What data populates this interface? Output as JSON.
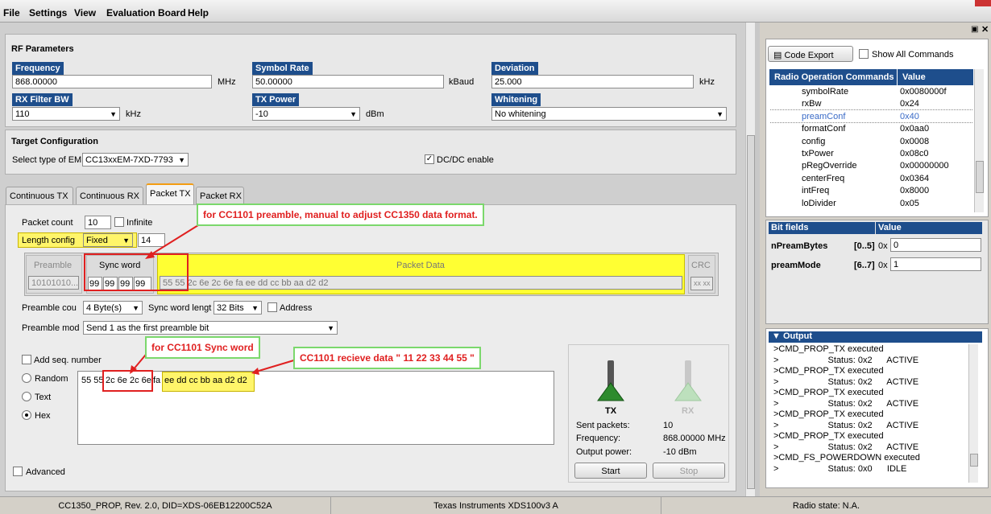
{
  "menu": [
    "File",
    "Settings",
    "View",
    "Evaluation Board",
    "Help"
  ],
  "rf": {
    "title": "RF Parameters",
    "frequency": {
      "label": "Frequency",
      "value": "868.00000",
      "unit": "MHz"
    },
    "symbol_rate": {
      "label": "Symbol Rate",
      "value": "50.00000",
      "unit": "kBaud"
    },
    "deviation": {
      "label": "Deviation",
      "value": "25.000",
      "unit": "kHz"
    },
    "rx_filter": {
      "label": "RX Filter BW",
      "value": "110",
      "unit": "kHz"
    },
    "tx_power": {
      "label": "TX Power",
      "value": "-10",
      "unit": "dBm"
    },
    "whitening": {
      "label": "Whitening",
      "value": "No whitening"
    }
  },
  "target": {
    "title": "Target Configuration",
    "em_label": "Select type of EM",
    "em_value": "CC13xxEM-7XD-7793",
    "dcdc_label": "DC/DC enable"
  },
  "tabs": [
    "Continuous TX",
    "Continuous RX",
    "Packet TX",
    "Packet RX"
  ],
  "packet": {
    "count_label": "Packet count",
    "count_value": "10",
    "infinite_label": "Infinite",
    "length_label": "Length config",
    "length_value": "Fixed",
    "length_num": "14",
    "preamble_head": "Preamble",
    "preamble_val": "10101010...",
    "sync_head": "Sync word",
    "sync_bytes": [
      "99",
      "99",
      "99",
      "99"
    ],
    "data_head": "Packet Data",
    "data_val": "55 55 2c 6e 2c 6e fa ee dd cc bb aa d2 d2",
    "crc_head": "CRC",
    "crc_val": "xx xx",
    "pre_count_label": "Preamble cou",
    "pre_count_val": "4 Byte(s)",
    "sync_len_label": "Sync word lengt",
    "sync_len_val": "32 Bits",
    "address_label": "Address",
    "pre_mode_label": "Preamble mod",
    "pre_mode_val": "Send 1 as the first preamble bit",
    "seq_label": "Add seq. number",
    "random_label": "Random",
    "text_label": "Text",
    "hex_label": "Hex",
    "payload_a": "55 55",
    "payload_b": "2c 6e 2c 6e",
    "payload_c": "fa",
    "payload_d": "ee dd cc bb aa d2 d2",
    "advanced_label": "Advanced"
  },
  "annotations": {
    "a1": "for CC1101 preamble, manual to adjust CC1350 data format.",
    "a2": "for CC1101 Sync word",
    "a3": "CC1101 recieve data \" 11 22 33 44 55 \""
  },
  "status": {
    "tx_label": "TX",
    "rx_label": "RX",
    "sent_label": "Sent packets:",
    "sent_val": "10",
    "freq_label": "Frequency:",
    "freq_val": "868.00000 MHz",
    "pow_label": "Output power:",
    "pow_val": "-10 dBm",
    "start": "Start",
    "stop": "Stop"
  },
  "right": {
    "code_export": "Code Export",
    "show_all": "Show All Commands",
    "col1": "Radio Operation Commands",
    "col2": "Value",
    "cmds": [
      [
        "symbolRate",
        "0x0080000f"
      ],
      [
        "rxBw",
        "0x24"
      ],
      [
        "preamConf",
        "0x40"
      ],
      [
        "formatConf",
        "0x0aa0"
      ],
      [
        "config",
        "0x0008"
      ],
      [
        "txPower",
        "0x08c0"
      ],
      [
        "pRegOverride",
        "0x00000000"
      ],
      [
        "centerFreq",
        "0x0364"
      ],
      [
        "intFreq",
        "0x8000"
      ],
      [
        "loDivider",
        "0x05"
      ]
    ],
    "bit_head": "Bit fields",
    "val_head": "Value",
    "bits": [
      [
        "nPreamBytes",
        "[0..5]",
        "0x",
        "0"
      ],
      [
        "preamMode",
        "[6..7]",
        "0x",
        "1"
      ]
    ],
    "output_title": "Output",
    "output": [
      ">CMD_PROP_TX executed",
      ">                    Status: 0x2      ACTIVE",
      ">CMD_PROP_TX executed",
      ">                    Status: 0x2      ACTIVE",
      ">CMD_PROP_TX executed",
      ">                    Status: 0x2      ACTIVE",
      ">CMD_PROP_TX executed",
      ">                    Status: 0x2      ACTIVE",
      ">CMD_PROP_TX executed",
      ">                    Status: 0x2      ACTIVE",
      ">CMD_FS_POWERDOWN executed",
      ">                    Status: 0x0      IDLE"
    ]
  },
  "statusbar": {
    "device": "CC1350_PROP, Rev. 2.0, DID=XDS-06EB12200C52A",
    "probe": "Texas Instruments XDS100v3 A",
    "radio": "Radio state: N.A."
  }
}
